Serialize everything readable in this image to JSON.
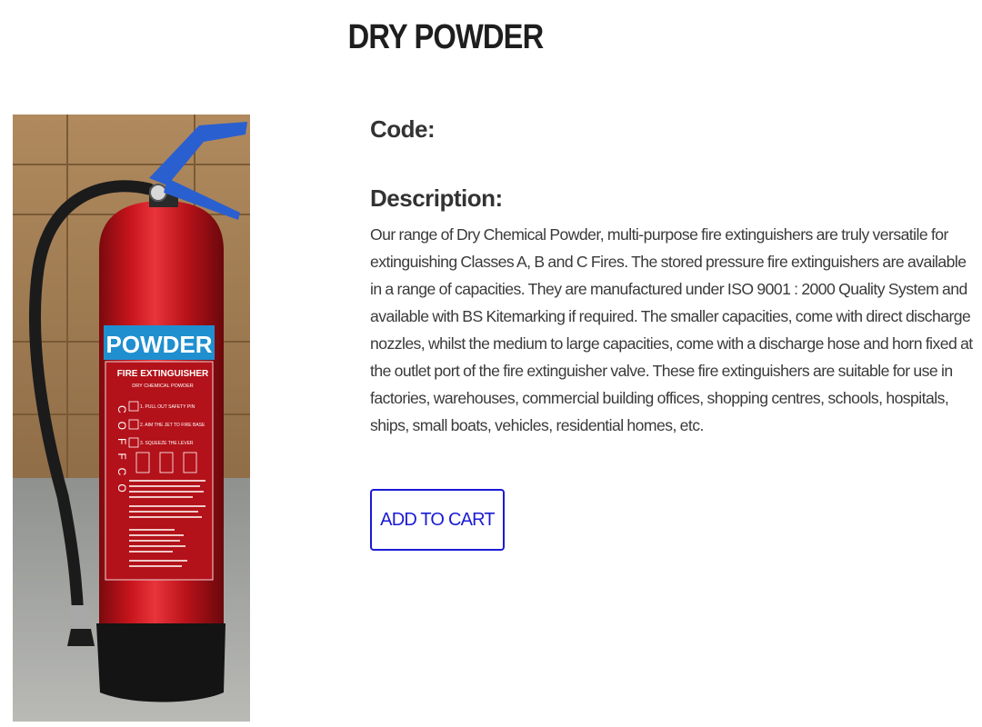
{
  "product": {
    "title": "DRY POWDER",
    "image": {
      "label_powder": "POWDER",
      "label_fire_extinguisher": "FIRE EXTINGUISHER",
      "label_dry_chemical": "DRY CHEMICAL POWDER",
      "label_brand_vertical": "COFFCO",
      "instruction_1": "1. PULL OUT SAFETY PIN",
      "instruction_2": "2. AIM THE JET TO FIRE BASE",
      "instruction_3": "3. SQUEEZE THE LEVER"
    }
  },
  "fields": {
    "code_label": "Code:",
    "description_label": "Description:",
    "description_text": "Our range of Dry Chemical Powder, multi-purpose fire extinguishers are truly versatile for extinguishing Classes A, B and C Fires. The stored pressure fire extinguishers are available in a range of capacities. They are manufactured under ISO 9001 : 2000 Quality System and available with BS Kitemarking if required. The smaller capacities, come with direct discharge nozzles, whilst the medium to large capacities, come with a discharge hose and horn fixed at the outlet port of the fire extinguisher valve. These fire extinguishers are suitable for use in factories, warehouses, commercial building offices, shopping centres, schools, hospitals, ships, small boats, vehicles, residential homes, etc."
  },
  "actions": {
    "add_to_cart_label": "ADD TO CART"
  },
  "colors": {
    "accent": "#1a1ad6",
    "extinguisher_red": "#c8141c",
    "label_blue": "#1f8fd0",
    "handle_blue": "#2a5fd0"
  }
}
